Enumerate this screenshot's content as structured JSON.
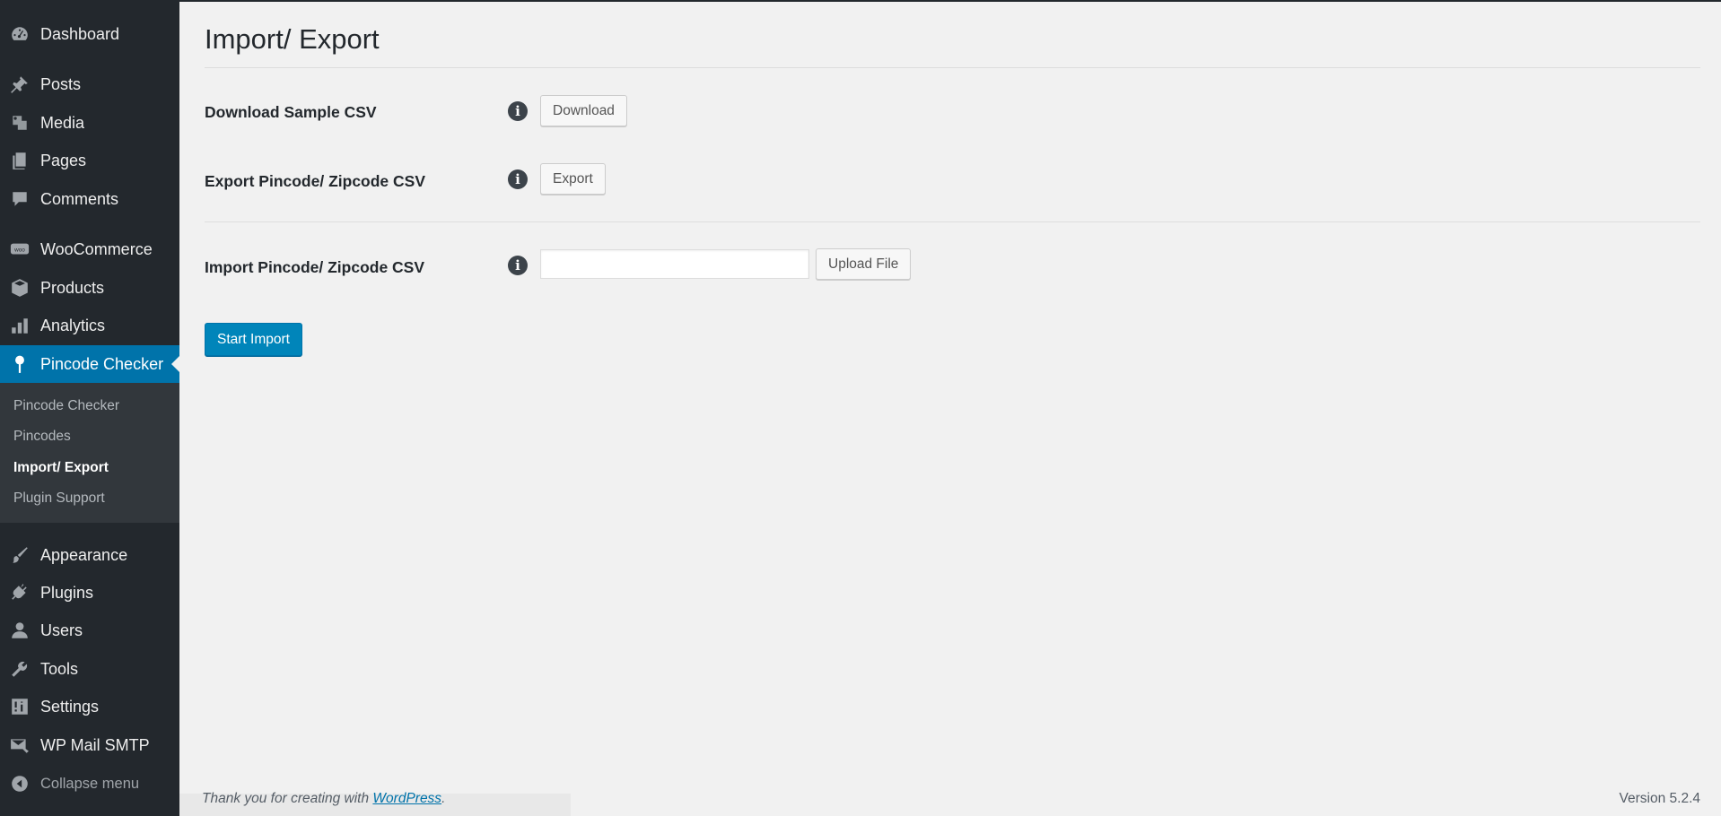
{
  "sidebar": {
    "items": [
      {
        "label": "Dashboard",
        "icon": "dashboard-icon"
      },
      {
        "label": "Posts",
        "icon": "pushpin-icon"
      },
      {
        "label": "Media",
        "icon": "media-icon"
      },
      {
        "label": "Pages",
        "icon": "pages-icon"
      },
      {
        "label": "Comments",
        "icon": "comment-icon"
      },
      {
        "label": "WooCommerce",
        "icon": "woocommerce-icon"
      },
      {
        "label": "Products",
        "icon": "box-icon"
      },
      {
        "label": "Analytics",
        "icon": "bar-chart-icon"
      },
      {
        "label": "Pincode Checker",
        "icon": "location-pin-icon"
      },
      {
        "label": "Appearance",
        "icon": "paintbrush-icon"
      },
      {
        "label": "Plugins",
        "icon": "plug-icon"
      },
      {
        "label": "Users",
        "icon": "user-icon"
      },
      {
        "label": "Tools",
        "icon": "wrench-icon"
      },
      {
        "label": "Settings",
        "icon": "sliders-icon"
      },
      {
        "label": "WP Mail SMTP",
        "icon": "mail-icon"
      }
    ],
    "submenu": [
      "Pincode Checker",
      "Pincodes",
      "Import/ Export",
      "Plugin Support"
    ],
    "collapse_label": "Collapse menu"
  },
  "page": {
    "title": "Import/ Export",
    "download_label": "Download Sample CSV",
    "download_button": "Download",
    "export_label": "Export Pincode/ Zipcode CSV",
    "export_button": "Export",
    "import_label": "Import Pincode/ Zipcode CSV",
    "import_value": "",
    "upload_button": "Upload File",
    "start_button": "Start Import"
  },
  "footer": {
    "thanks_prefix": "Thank you for creating with ",
    "thanks_link": "WordPress",
    "thanks_suffix": ".",
    "version": "Version 5.2.4"
  },
  "colors": {
    "sidebar_bg": "#23282d",
    "submenu_bg": "#32373c",
    "accent": "#0073aa",
    "primary_button": "#0085ba",
    "page_bg": "#f1f1f1"
  }
}
